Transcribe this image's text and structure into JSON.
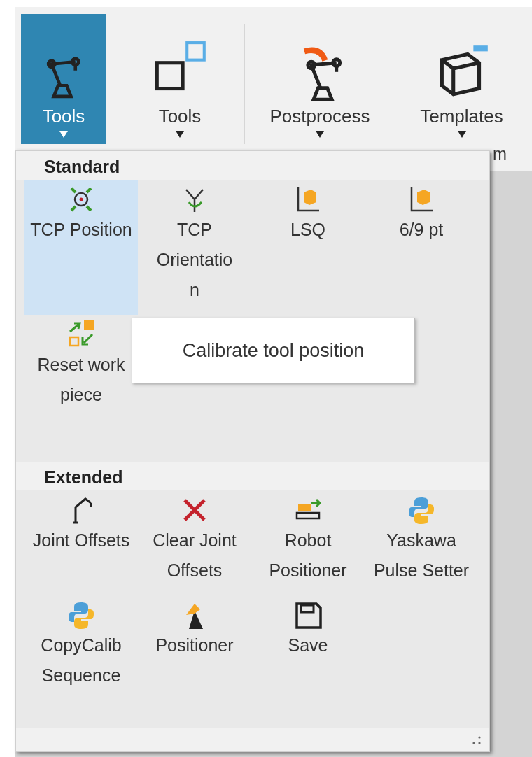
{
  "ribbon": {
    "buttons": [
      {
        "label": "Tools",
        "kind": "robot",
        "selected": true
      },
      {
        "label": "Tools",
        "kind": "frames",
        "selected": false
      },
      {
        "label": "Postprocess",
        "kind": "robot-arrow",
        "selected": false
      },
      {
        "label": "Templates",
        "kind": "cube",
        "selected": false
      }
    ],
    "group_label": "m"
  },
  "menu": {
    "sections": [
      {
        "title": "Standard",
        "items": [
          {
            "label": "TCP Position",
            "kind": "target",
            "selected": true
          },
          {
            "label": "TCP Orientation",
            "kind": "orient",
            "selected": false
          },
          {
            "label": "LSQ",
            "kind": "axes-cube",
            "selected": false
          },
          {
            "label": "6/9 pt",
            "kind": "axes-cube",
            "selected": false
          },
          {
            "label": "Reset work piece",
            "kind": "reset",
            "selected": false
          }
        ]
      },
      {
        "title": "Extended",
        "items": [
          {
            "label": "Joint Offsets",
            "kind": "joint",
            "selected": false
          },
          {
            "label": "Clear Joint Offsets",
            "kind": "cross",
            "selected": false
          },
          {
            "label": "Robot Positioner",
            "kind": "rail",
            "selected": false
          },
          {
            "label": "Yaskawa Pulse Setter",
            "kind": "python",
            "selected": false
          },
          {
            "label": "CopyCalib Sequence",
            "kind": "python",
            "selected": false
          },
          {
            "label": "Positioner",
            "kind": "cone",
            "selected": false
          },
          {
            "label": "Save",
            "kind": "save",
            "selected": false
          }
        ]
      }
    ]
  },
  "tooltip": "Calibrate tool position"
}
